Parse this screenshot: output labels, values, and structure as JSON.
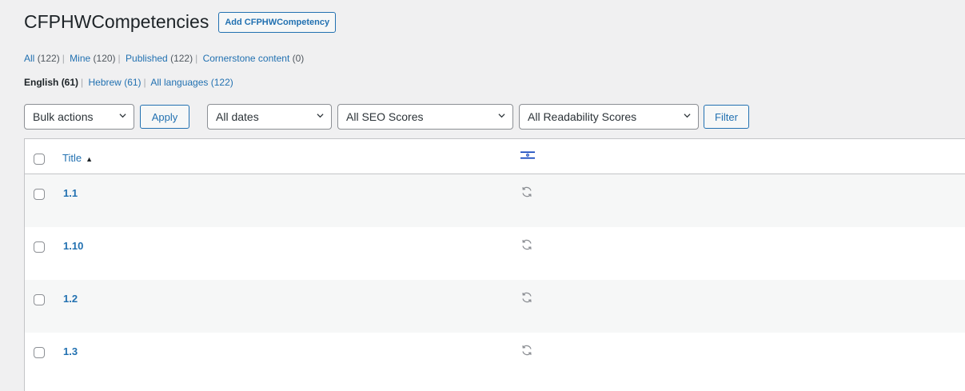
{
  "header": {
    "title": "CFPHWCompetencies",
    "add_button": "Add CFPHWCompetency"
  },
  "views": [
    {
      "label": "All",
      "count": "(122)"
    },
    {
      "label": "Mine",
      "count": "(120)"
    },
    {
      "label": "Published",
      "count": "(122)"
    },
    {
      "label": "Cornerstone content",
      "count": "(0)"
    }
  ],
  "languages": [
    {
      "label": "English",
      "count": "(61)"
    },
    {
      "label": "Hebrew",
      "count": "(61)"
    },
    {
      "label": "All languages",
      "count": "(122)"
    }
  ],
  "filters": {
    "bulk_actions": "Bulk actions",
    "apply": "Apply",
    "dates": "All dates",
    "seo": "All SEO Scores",
    "readability": "All Readability Scores",
    "filter": "Filter"
  },
  "table": {
    "title_header": "Title",
    "sort_indicator": "▲",
    "flag_icon": "israel-flag-icon",
    "status_icon": "sync-icon",
    "rows": [
      {
        "title": "1.1"
      },
      {
        "title": "1.10"
      },
      {
        "title": "1.2"
      },
      {
        "title": "1.3"
      }
    ]
  },
  "colors": {
    "link": "#2271b1",
    "background": "#f0f0f1",
    "flag_blue": "#0038b8"
  }
}
